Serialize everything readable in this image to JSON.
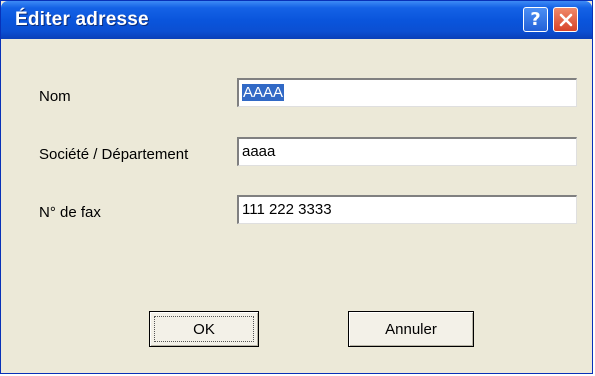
{
  "window": {
    "title": "Éditer adresse",
    "help_glyph": "?"
  },
  "form": {
    "name_label": "Nom",
    "name_value": "AAAA",
    "company_label": "Société / Département",
    "company_value": "aaaa",
    "fax_label": "N° de fax",
    "fax_value": "111 222 3333"
  },
  "buttons": {
    "ok_label": "OK",
    "cancel_label": "Annuler"
  },
  "icons": {
    "help": "question-mark-icon",
    "close": "close-x-icon"
  },
  "colors": {
    "titlebar": "#0a55dc",
    "dialog_bg": "#ece9d8",
    "selection": "#3169c6",
    "close_button": "#d7442a"
  }
}
